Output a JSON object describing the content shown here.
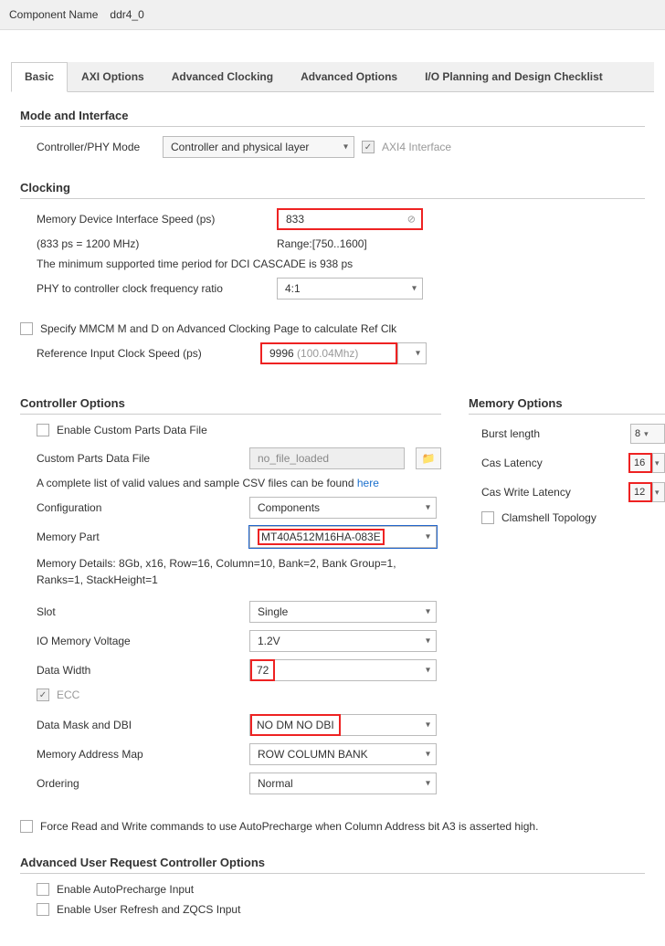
{
  "header": {
    "label": "Component Name",
    "value": "ddr4_0"
  },
  "tabs": [
    "Basic",
    "AXI Options",
    "Advanced Clocking",
    "Advanced Options",
    "I/O Planning and Design Checklist"
  ],
  "mode_interface": {
    "title": "Mode and Interface",
    "controller_label": "Controller/PHY Mode",
    "controller_value": "Controller and physical layer",
    "axi4_label": "AXI4 Interface"
  },
  "clocking": {
    "title": "Clocking",
    "mem_speed_label": "Memory Device Interface Speed (ps)",
    "mem_speed_value": "833",
    "mem_speed_note": "(833 ps = 1200 MHz)",
    "range_label": "Range:[750..1600]",
    "min_period_note": "The minimum supported time period for DCI CASCADE is 938 ps",
    "phy_ratio_label": "PHY to controller clock frequency ratio",
    "phy_ratio_value": "4:1",
    "mmcm_label": "Specify MMCM M and D on Advanced Clocking Page to calculate Ref Clk",
    "ref_clk_label": "Reference Input Clock Speed (ps)",
    "ref_clk_value": "9996",
    "ref_clk_freq": "(100.04Mhz)"
  },
  "controller": {
    "title": "Controller Options",
    "enable_custom_label": "Enable Custom Parts Data File",
    "custom_file_label": "Custom Parts Data File",
    "custom_file_placeholder": "no_file_loaded",
    "csv_note_a": "A complete list of valid values and sample CSV files can be found ",
    "csv_note_link": "here",
    "config_label": "Configuration",
    "config_value": "Components",
    "mempart_label": "Memory Part",
    "mempart_value": "MT40A512M16HA-083E",
    "mem_details": "Memory Details: 8Gb, x16, Row=16, Column=10, Bank=2, Bank Group=1, Ranks=1, StackHeight=1",
    "slot_label": "Slot",
    "slot_value": "Single",
    "voltage_label": "IO Memory Voltage",
    "voltage_value": "1.2V",
    "datawidth_label": "Data Width",
    "datawidth_value": "72",
    "ecc_label": "ECC",
    "dm_dbi_label": "Data Mask and DBI",
    "dm_dbi_value": "NO DM NO DBI",
    "addrmap_label": "Memory Address Map",
    "addrmap_value": "ROW COLUMN BANK",
    "ordering_label": "Ordering",
    "ordering_value": "Normal",
    "force_label": "Force Read and Write commands to use AutoPrecharge when Column Address bit A3 is asserted high."
  },
  "memory_options": {
    "title": "Memory Options",
    "burst_label": "Burst length",
    "burst_value": "8",
    "cas_label": "Cas Latency",
    "cas_value": "16",
    "caswrite_label": "Cas Write Latency",
    "caswrite_value": "12",
    "clamshell_label": "Clamshell Topology"
  },
  "advanced_user": {
    "title": "Advanced User Request Controller Options",
    "autoprecharge_label": "Enable AutoPrecharge Input",
    "zqcs_label": "Enable User Refresh and ZQCS Input"
  }
}
